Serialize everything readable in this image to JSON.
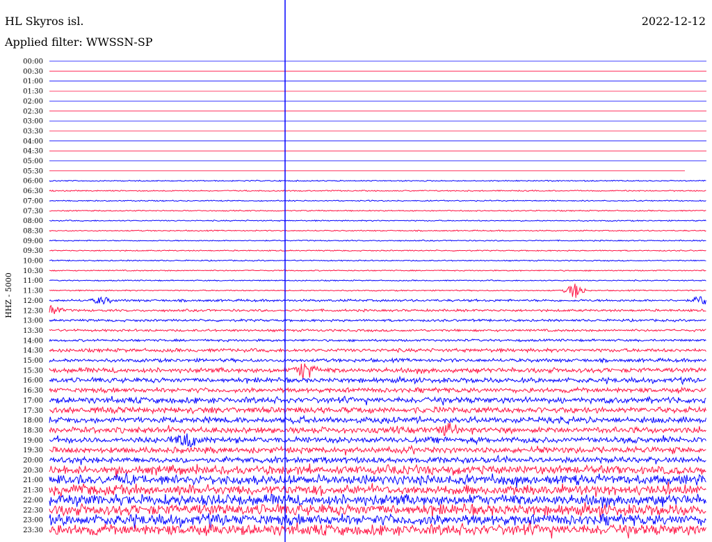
{
  "header": {
    "station": "HL Skyros isl.",
    "filter": "Applied filter: WWSSN-SP",
    "date": "2022-12-12"
  },
  "chart_data": {
    "type": "line",
    "channel_label": "HHZ - 5000",
    "row_labels": [
      "00:00",
      "00:30",
      "01:00",
      "01:30",
      "02:00",
      "02:30",
      "03:00",
      "03:30",
      "04:00",
      "04:30",
      "05:00",
      "05:30",
      "06:00",
      "06:30",
      "07:00",
      "07:30",
      "08:00",
      "08:30",
      "09:00",
      "09:30",
      "10:00",
      "10:30",
      "11:00",
      "11:30",
      "12:00",
      "12:30",
      "13:00",
      "13:30",
      "14:00",
      "14:30",
      "15:00",
      "15:30",
      "16:00",
      "16:30",
      "17:00",
      "17:30",
      "18:00",
      "18:30",
      "19:00",
      "19:30",
      "20:00",
      "20:30",
      "21:00",
      "21:30",
      "22:00",
      "22:30",
      "23:00",
      "23:30"
    ],
    "colors": {
      "blue": "#0000ff",
      "red": "#ff1040"
    },
    "row_amplitude": [
      0,
      0,
      0,
      0,
      0,
      0,
      0,
      0,
      0,
      0,
      0,
      0,
      1,
      1,
      1,
      1,
      1,
      1,
      1,
      1,
      1,
      1,
      1,
      1,
      2,
      2,
      2,
      2,
      2,
      3,
      3,
      4,
      4,
      4,
      5,
      5,
      5,
      5,
      5,
      5,
      5,
      7,
      8,
      8,
      9,
      9,
      9,
      9
    ],
    "gap_rows": [
      0,
      1,
      2,
      3,
      4,
      5,
      6,
      7,
      8,
      9,
      10,
      11
    ],
    "events": [
      {
        "row": 23,
        "pos": 0.8,
        "amp": 11
      },
      {
        "row": 24,
        "pos": 0.08,
        "amp": 5
      },
      {
        "row": 24,
        "pos": 0.995,
        "amp": 7
      },
      {
        "row": 25,
        "pos": 0.005,
        "amp": 7
      },
      {
        "row": 31,
        "pos": 0.39,
        "amp": 14
      },
      {
        "row": 38,
        "pos": 0.21,
        "amp": 12
      },
      {
        "row": 37,
        "pos": 0.61,
        "amp": 8
      }
    ],
    "time_marker": 0.358
  }
}
